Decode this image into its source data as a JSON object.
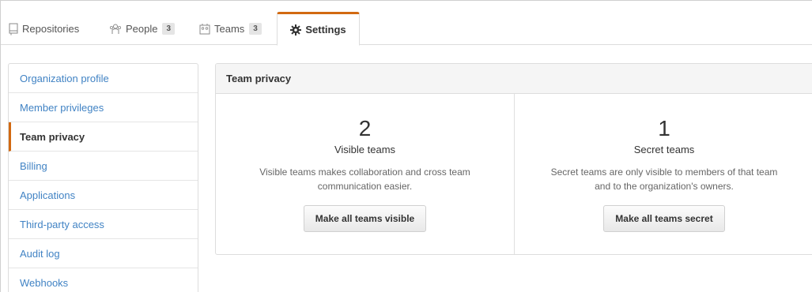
{
  "tabs": {
    "repositories": {
      "label": "Repositories",
      "icon": "repo-icon"
    },
    "people": {
      "label": "People",
      "count": "3",
      "icon": "people-icon"
    },
    "teams": {
      "label": "Teams",
      "count": "3",
      "icon": "teams-icon"
    },
    "settings": {
      "label": "Settings",
      "icon": "gear-icon"
    }
  },
  "sidebar": {
    "items": [
      {
        "label": "Organization profile"
      },
      {
        "label": "Member privileges"
      },
      {
        "label": "Team privacy"
      },
      {
        "label": "Billing"
      },
      {
        "label": "Applications"
      },
      {
        "label": "Third-party access"
      },
      {
        "label": "Audit log"
      },
      {
        "label": "Webhooks"
      }
    ],
    "selected": "Team privacy"
  },
  "panel": {
    "title": "Team privacy",
    "visible": {
      "count": "2",
      "label": "Visible teams",
      "description": "Visible teams makes collaboration and cross team communication easier.",
      "button": "Make all teams visible"
    },
    "secret": {
      "count": "1",
      "label": "Secret teams",
      "description": "Secret teams are only visible to members of that team and to the organization's owners.",
      "button": "Make all teams secret"
    }
  },
  "colors": {
    "accent": "#d26911",
    "link": "#4183c4",
    "border": "#dddddd",
    "header_bg": "#f5f5f5"
  }
}
